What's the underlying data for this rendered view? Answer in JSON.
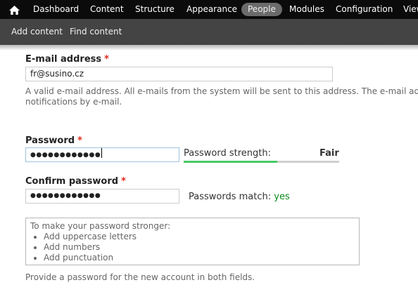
{
  "toolbar": {
    "menu": [
      {
        "label": "Dashboard"
      },
      {
        "label": "Content"
      },
      {
        "label": "Structure"
      },
      {
        "label": "Appearance"
      },
      {
        "label": "People",
        "active": true
      },
      {
        "label": "Modules"
      },
      {
        "label": "Configuration"
      },
      {
        "label": "View"
      }
    ],
    "shortcuts": [
      "Add content",
      "Find content"
    ]
  },
  "form": {
    "email": {
      "label": "E-mail address",
      "required": "*",
      "value": "fr@susino.cz",
      "description_line1": "A valid e-mail address. All e-mails from the system will be sent to this address. The e-mail add",
      "description_line2": "notifications by e-mail."
    },
    "password": {
      "label": "Password",
      "required": "*",
      "masked_value": "●●●●●●●●●●●●",
      "strength_label": "Password strength:",
      "strength_value": "Fair",
      "strength_fraction": 0.6
    },
    "confirm": {
      "label": "Confirm password",
      "required": "*",
      "masked_value": "●●●●●●●●●●●●",
      "match_label": "Passwords match:",
      "match_value": "yes"
    },
    "tips": {
      "heading": "To make your password stronger:",
      "items": [
        "Add uppercase letters",
        "Add numbers",
        "Add punctuation"
      ]
    },
    "password_description": "Provide a password for the new account in both fields."
  },
  "colors": {
    "toolbar": "#0b0b0b",
    "shortcut_bar": "#444444",
    "required": "#e0261b",
    "strength_fill": "#47c965",
    "match_yes": "#0a8a1b"
  }
}
